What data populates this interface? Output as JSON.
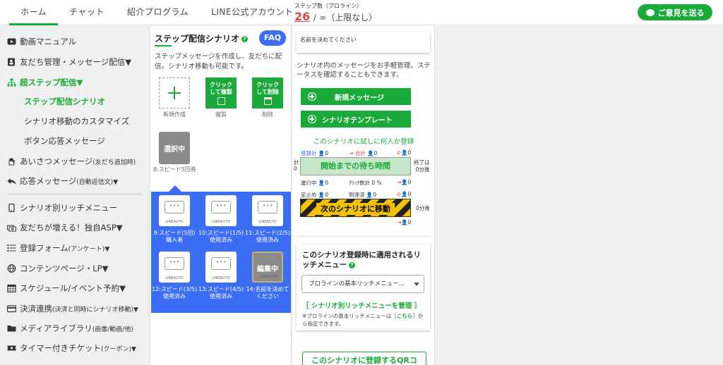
{
  "topnav": {
    "tabs": [
      "ホーム",
      "チャット",
      "紹介プログラム",
      "LINE公式アカウント"
    ],
    "active_index": 0
  },
  "step_count": {
    "label": "ステップ数（プロライン）",
    "used": "26",
    "separator": "/",
    "limit": "∞（上限なし）"
  },
  "feedback_button": "ご意見を送る",
  "sidebar": {
    "items": [
      {
        "label": "動画マニュアル",
        "small": "",
        "icon": "video-icon"
      },
      {
        "label": "友だち管理・メッセージ配信▼",
        "small": "",
        "icon": "contact-book-icon"
      },
      {
        "label": "超ステップ配信▼",
        "small": "",
        "icon": "sitemap-icon"
      },
      {
        "label": "あいさつメッセージ",
        "small": "(友だち追加時)",
        "icon": "hand-icon"
      },
      {
        "label": "応答メッセージ",
        "small": "(自動返信文)▼",
        "icon": "reply-icon"
      },
      {
        "label": "シナリオ別リッチメニュー",
        "small": "",
        "icon": "mobile-icon"
      },
      {
        "label": "友だちが増える！独自ASP▼",
        "small": "",
        "icon": "money-icon"
      },
      {
        "label": "登録フォーム",
        "small": "(アンケート)▼",
        "icon": "list-icon"
      },
      {
        "label": "コンテンツページ・LP▼",
        "small": "",
        "icon": "globe-icon"
      },
      {
        "label": "スケジュール/イベント予約▼",
        "small": "",
        "icon": "calendar-icon"
      },
      {
        "label": "決済連携",
        "small": "(決済と同時にシナリオ移動)▼",
        "icon": "credit-card-icon"
      },
      {
        "label": "メディアライブラリ",
        "small": "(画像/動画/他)",
        "icon": "folder-icon"
      },
      {
        "label": "タイマー付きチケット",
        "small": "(クーポン)▼",
        "icon": "ticket-icon"
      }
    ],
    "submenu": [
      "ステップ配信シナリオ",
      "シナリオ移動のカスタマイズ",
      "ボタン応答メッセージ"
    ]
  },
  "scenario_panel": {
    "title": "ステップ配信シナリオ",
    "help": "?",
    "faq": "FAQ",
    "description": "ステップメッセージを作成し、友だちに配信。シナリオ移動も可能です。",
    "actions": {
      "new_caption": "新規作成",
      "copy_label": "クリックして複製",
      "copy_caption": "複製",
      "delete_label": "クリックして削除",
      "delete_caption": "削除"
    },
    "selected": {
      "overlay": "選択中",
      "caption": "8:スピード5回券"
    },
    "scenarios": [
      {
        "brand": "LINEAUTO",
        "label": "9:スピード(5回)購入者"
      },
      {
        "brand": "LINEAUTO",
        "label": "10:スピード(1/5)使用済み"
      },
      {
        "brand": "LINEAUTO",
        "label": "11:スピード(2/5)使用済み"
      },
      {
        "brand": "LINEAUTO",
        "label": "12:スピード(3/5)使用済み"
      },
      {
        "brand": "LINEAUTO",
        "label": "13:スピード(4/5)使用済み"
      },
      {
        "brand": "LINEAUTO",
        "label": "14:名前を決めてください",
        "overlay": "編集中"
      }
    ]
  },
  "detail_panel": {
    "name_placeholder": "名前を決めてください",
    "description": "シナリオ内のメッセージをお手軽管理。ステータスを確認することもできます。",
    "new_message": "新規メッセージ",
    "template": "シナリオテンプレート",
    "try_register": "このシナリオに試しに何人か登録",
    "stats": {
      "registered_label": "登録計",
      "registered": "0",
      "total_label": "合計",
      "total": "0",
      "stopped": "0",
      "left_total": "計",
      "left_total_value": "0",
      "end_label": "終了は",
      "end_value": "0分後",
      "in_progress_label": "進行中",
      "in_progress": "0",
      "click_rate_label": "ｸﾘｯｸ数計",
      "click_rate": "0 %",
      "stop_move": "0",
      "stopped_label": "足止め",
      "stopped_count": "0",
      "reach_rate_label": "到達済",
      "reach_rate": "0",
      "blocked": "0",
      "next_after": "0分後",
      "move_out": "0"
    },
    "wait_label": "開始までの待ち時間",
    "next_scenario": "次のシナリオに移動",
    "rich_menu": {
      "title": "このシナリオ登録時に適用されるリッチメニュー",
      "help": "?",
      "selected": "プロラインの基本リッチメニュー…",
      "manage_link": "［ シナリオ別リッチメニューを管理 ］",
      "note_prefix": "※プロラインの基本リッチメニューは［",
      "note_link": "こちら",
      "note_suffix": "］から指定できます。"
    },
    "qr_button": "このシナリオに登録するQRコ"
  },
  "colors": {
    "accent_green": "#1aaa3a",
    "accent_blue": "#3b6ef5",
    "warning_red": "#d94b4b",
    "stripe_yellow": "#f2c200"
  }
}
